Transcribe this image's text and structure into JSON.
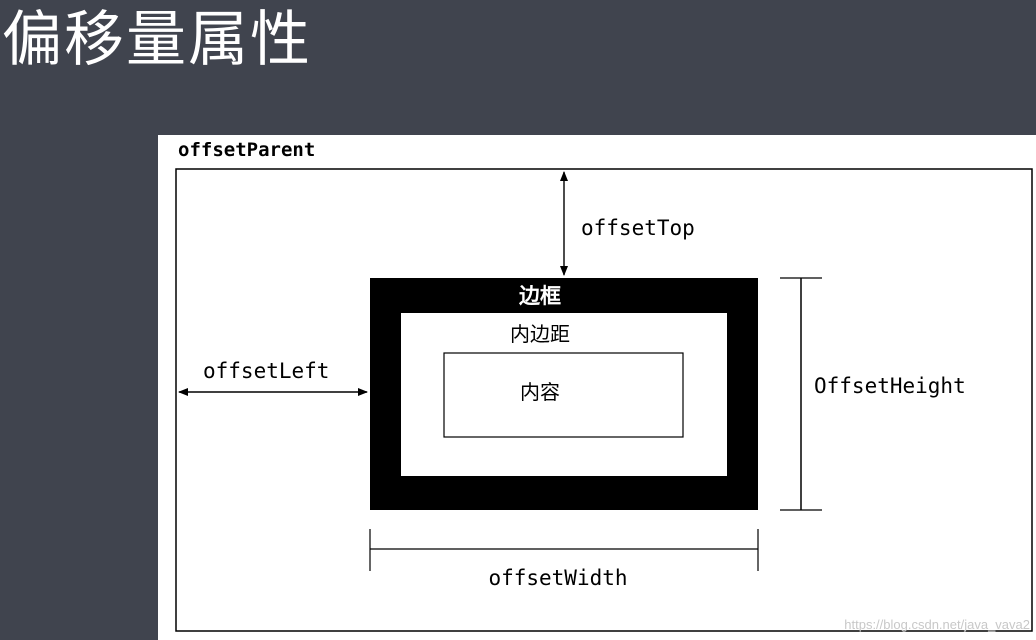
{
  "title": "偏移量属性",
  "diagram": {
    "parent_label": "offsetParent",
    "offset_top_label": "offsetTop",
    "offset_left_label": "offsetLeft",
    "offset_height_label": "OffsetHeight",
    "offset_width_label": "offsetWidth",
    "border_label": "边框",
    "padding_label": "内边距",
    "content_label": "内容"
  },
  "watermark": "https://blog.csdn.net/java_vava2"
}
